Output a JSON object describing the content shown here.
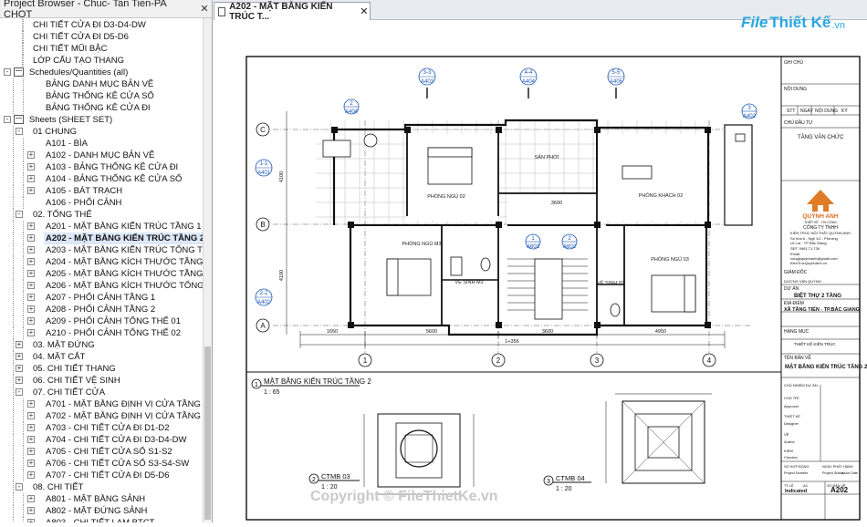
{
  "browser": {
    "title": "Project Browser - Chuc- Tan Tien-PA CHOT",
    "close": "✕",
    "rows": [
      {
        "label": "CHI TIẾT CỬA ĐI D3-D4-DW",
        "level": 3,
        "tog": ""
      },
      {
        "label": "CHI TIẾT CỬA ĐI D5-D6",
        "level": 3,
        "tog": ""
      },
      {
        "label": "CHI TIẾT MŨI BẬC",
        "level": 3,
        "tog": ""
      },
      {
        "label": "LỚP CẤU TẠO THANG",
        "level": 3,
        "tog": ""
      },
      {
        "label": "Schedules/Quantities (all)",
        "level": 0,
        "tog": "-",
        "icon": true
      },
      {
        "label": "BẢNG DANH MỤC BẢN VẼ",
        "level": 2,
        "tog": ""
      },
      {
        "label": "BẢNG THỐNG KÊ CỬA SỔ",
        "level": 2,
        "tog": ""
      },
      {
        "label": "BẢNG THỐNG KÊ CỬA ĐI",
        "level": 2,
        "tog": ""
      },
      {
        "label": "Sheets (SHEET SET)",
        "level": 0,
        "tog": "-",
        "icon": true
      },
      {
        "label": "01 CHUNG",
        "level": 1,
        "tog": "-"
      },
      {
        "label": "A101 - BÌA",
        "level": 2,
        "tog": ""
      },
      {
        "label": "A102 - DANH MỤC BẢN VẼ",
        "level": 2,
        "tog": "+"
      },
      {
        "label": "A103 - BẢNG THỐNG KÊ CỬA ĐI",
        "level": 2,
        "tog": "+"
      },
      {
        "label": "A104 - BẢNG THỐNG KÊ CỬA SỔ",
        "level": 2,
        "tog": "+"
      },
      {
        "label": "A105 - BÁT TRẠCH",
        "level": 2,
        "tog": "+"
      },
      {
        "label": "A106 - PHỐI CẢNH",
        "level": 2,
        "tog": ""
      },
      {
        "label": "02. TỔNG THỂ",
        "level": 1,
        "tog": "-"
      },
      {
        "label": "A201 - MẶT BẰNG KIẾN TRÚC TẦNG 1",
        "level": 2,
        "tog": "+"
      },
      {
        "label": "A202 - MẶT BẰNG KIẾN TRÚC TẦNG 2",
        "level": 2,
        "tog": "+",
        "selected": true
      },
      {
        "label": "A203 - MẶT BẰNG KIẾN TRÚC TỔNG THỂ",
        "level": 2,
        "tog": "+"
      },
      {
        "label": "A204 - MẶT BẰNG KÍCH THƯỚC TẦNG 1",
        "level": 2,
        "tog": "+"
      },
      {
        "label": "A205 - MẶT BẰNG KÍCH THƯỚC TẦNG 2",
        "level": 2,
        "tog": "+"
      },
      {
        "label": "A206 - MẶT BẰNG KÍCH THƯỚC TỔNG THỂ",
        "level": 2,
        "tog": "+"
      },
      {
        "label": "A207 - PHỐI CẢNH TẦNG 1",
        "level": 2,
        "tog": "+"
      },
      {
        "label": "A208 - PHỐI CẢNH TẦNG 2",
        "level": 2,
        "tog": "+"
      },
      {
        "label": "A209 - PHỐI CẢNH TỔNG THỂ 01",
        "level": 2,
        "tog": "+"
      },
      {
        "label": "A210 - PHỐI CẢNH TỔNG THỂ 02",
        "level": 2,
        "tog": "+"
      },
      {
        "label": "03. MẶT ĐỨNG",
        "level": 1,
        "tog": "+"
      },
      {
        "label": "04. MẶT CẮT",
        "level": 1,
        "tog": "+"
      },
      {
        "label": "05. CHI TIẾT THANG",
        "level": 1,
        "tog": "+"
      },
      {
        "label": "06. CHI TIẾT VỆ SINH",
        "level": 1,
        "tog": "+"
      },
      {
        "label": "07. CHI TIẾT CỬA",
        "level": 1,
        "tog": "-"
      },
      {
        "label": "A701 - MẶT BẰNG ĐỊNH VỊ CỬA TẦNG 1",
        "level": 2,
        "tog": "+"
      },
      {
        "label": "A702 - MẶT BẰNG ĐỊNH VỊ CỬA TẦNG 2",
        "level": 2,
        "tog": "+"
      },
      {
        "label": "A703 - CHI TIẾT CỬA ĐI D1-D2",
        "level": 2,
        "tog": "+"
      },
      {
        "label": "A704 - CHI TIẾT CỬA ĐI D3-D4-DW",
        "level": 2,
        "tog": "+"
      },
      {
        "label": "A705 - CHI TIẾT CỬA SỔ S1-S2",
        "level": 2,
        "tog": "+"
      },
      {
        "label": "A706 - CHI TIẾT CỬA SỔ S3-S4-SW",
        "level": 2,
        "tog": "+"
      },
      {
        "label": "A707 - CHI TIẾT CỬA ĐI D5-D6",
        "level": 2,
        "tog": "+"
      },
      {
        "label": "08. CHI TIẾT",
        "level": 1,
        "tog": "-"
      },
      {
        "label": "A801 - MẶT BẰNG SẢNH",
        "level": 2,
        "tog": "+"
      },
      {
        "label": "A802 - MẶT ĐỨNG SẢNH",
        "level": 2,
        "tog": "+"
      },
      {
        "label": "A803 - CHI TIẾT LAM BTCT",
        "level": 2,
        "tog": "+"
      }
    ]
  },
  "view_tab": {
    "label": "A202 - MẶT BẰNG KIẾN TRÚC T...",
    "close": "✕"
  },
  "logo": {
    "file": "File",
    "thiet_ke": "Thiết Kế",
    "vn": ".vn"
  },
  "watermark": "Copyright © FileThietKe.vn",
  "drawing": {
    "grid_cols": [
      "1",
      "2",
      "3",
      "4"
    ],
    "grid_rows": [
      "C",
      "B",
      "A"
    ],
    "section_tags": [
      {
        "top": "3-3",
        "bot": "A403"
      },
      {
        "top": "4-4",
        "bot": "A404"
      },
      {
        "top": "5-5",
        "bot": "A405"
      },
      {
        "top": "2",
        "bot": "A404"
      },
      {
        "top": "3",
        "bot": "A402"
      },
      {
        "top": "1-1",
        "bot": "A401"
      },
      {
        "top": "2-2",
        "bot": "A402"
      },
      {
        "top": "1",
        "bot": "A603"
      },
      {
        "top": "2",
        "bot": "A602"
      }
    ],
    "rooms": {
      "ngu2": "PHÒNG NGỦ 02",
      "ban_phoi": "SÂN PHƠI",
      "khach2": "PHÒNG KHÁCH 02",
      "ngu3": "PHÒNG NGỦ M3",
      "vs_m3": "VỆ SINH M3",
      "vs_2": "VỆ SINH 02",
      "ngu_p": "PHÒNG NGỦ 03"
    },
    "dims": {
      "bottom": [
        "1650",
        "5600",
        "3600",
        "4950"
      ],
      "total": "1+356",
      "left1": "4100",
      "left2": "4100",
      "inner": "3600"
    },
    "view_titles": [
      {
        "num": "1",
        "name": "MẶT BẰNG KIẾN TRÚC TẦNG 2",
        "scale": "1 : 65"
      },
      {
        "num": "2",
        "name": "CTMB 03",
        "scale": "1 : 20"
      },
      {
        "num": "3",
        "name": "CTMB 04",
        "scale": "1 : 20"
      }
    ]
  },
  "title_block": {
    "ghi_chu": "GHI CHÚ",
    "noi_dung": "NỘI DUNG",
    "rev_cols": [
      "STT",
      "NGÀY",
      "NỘI DUNG",
      "KÝ"
    ],
    "chu_dau_tu_label": "CHỦ ĐẦU TƯ",
    "chu_dau_tu": "TĂNG VĂN CHỨC",
    "company_name": "QUỲNH ANH",
    "company_sub": "THIẾT KẾ · THI CÔNG",
    "company_line1": "CÔNG TY TNHH",
    "company_line2": "KIẾN TRÚC NỘI THẤT QUỲNH ANH",
    "company_line3": "Số nhà 6 - Ngõ 1/2 - Phường",
    "company_line4": "Lê Lợi - TP Bắc Giang",
    "phone_label": "SĐT: 0961.71.739",
    "email_label": "Email:",
    "email": "congtyquynhanh@gmail.com",
    "website": "KienTrucQuynhAnh.vn",
    "giam_doc_label": "GIÁM ĐỐC",
    "giam_doc": "DƯƠNG VĂN QUỲNH",
    "du_an_label": "DỰ ÁN",
    "du_an": "BIỆT THỰ 2 TẦNG",
    "dia_diem_label": "ĐỊA ĐIỂM",
    "dia_diem": "XÃ TĂNG TIẾN - TP.BẮC GIANG",
    "hang_muc_label": "HẠNG MỤC",
    "hang_muc": "THIẾT KẾ KIẾN TRÚC",
    "ten_bv_label": "TÊN BẢN VẼ",
    "ten_bv": "MẶT BẰNG KIẾN TRÚC TẦNG 2",
    "roles": [
      "CHỦ NHIỆM DỰ ÁN",
      "CHỦ TRÌ",
      "Approver",
      "THIẾT KẾ",
      "Designer",
      "VẼ",
      "Author",
      "KIỂM",
      "Checker"
    ],
    "sheet_row_labels": [
      "SỐ HỢP ĐỒNG",
      "Project Number",
      "NGÀY PHÁT HÀNH",
      "Issue Date",
      "TỶ LỆ"
    ],
    "sheet_row_values": [
      "Project Status",
      "Issue Date",
      "Indicated"
    ],
    "so_bv_label": "SỐ BẢN VẼ",
    "so_bv": "A202",
    "scale_label": "A3",
    "scale_value": "Indicated"
  }
}
